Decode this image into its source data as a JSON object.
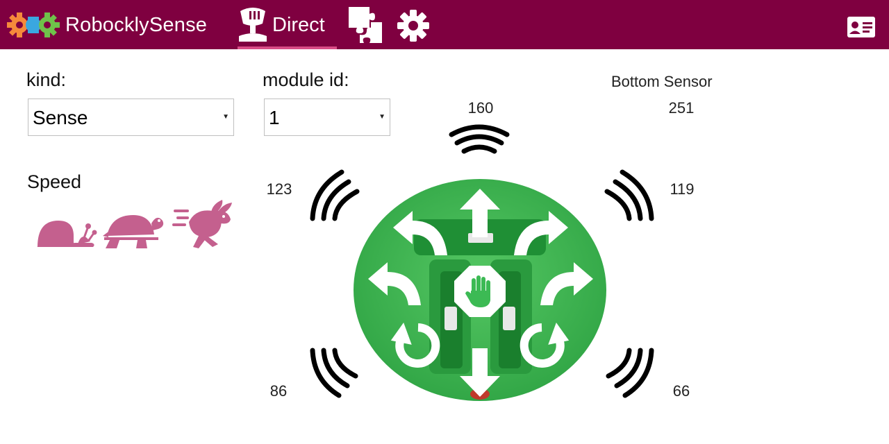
{
  "app": {
    "brand_name": "RobocklySense"
  },
  "nav": {
    "tab_direct": "Direct"
  },
  "kind": {
    "label": "kind:",
    "selected": "Sense"
  },
  "module": {
    "label": "module id:",
    "selected": "1"
  },
  "speed": {
    "label": "Speed",
    "options": [
      "slow-snail-icon",
      "medium-turtle-icon",
      "fast-rabbit-icon"
    ]
  },
  "sensors": {
    "bottom_label": "Bottom Sensor",
    "bottom_value": "251",
    "front": "160",
    "front_left": "123",
    "front_right": "119",
    "rear_left": "86",
    "rear_right": "66"
  },
  "colors": {
    "header": "#7f0040",
    "accent": "#d84c86",
    "speed_icons": "#c4608e",
    "robot_green": "#3cba54"
  }
}
